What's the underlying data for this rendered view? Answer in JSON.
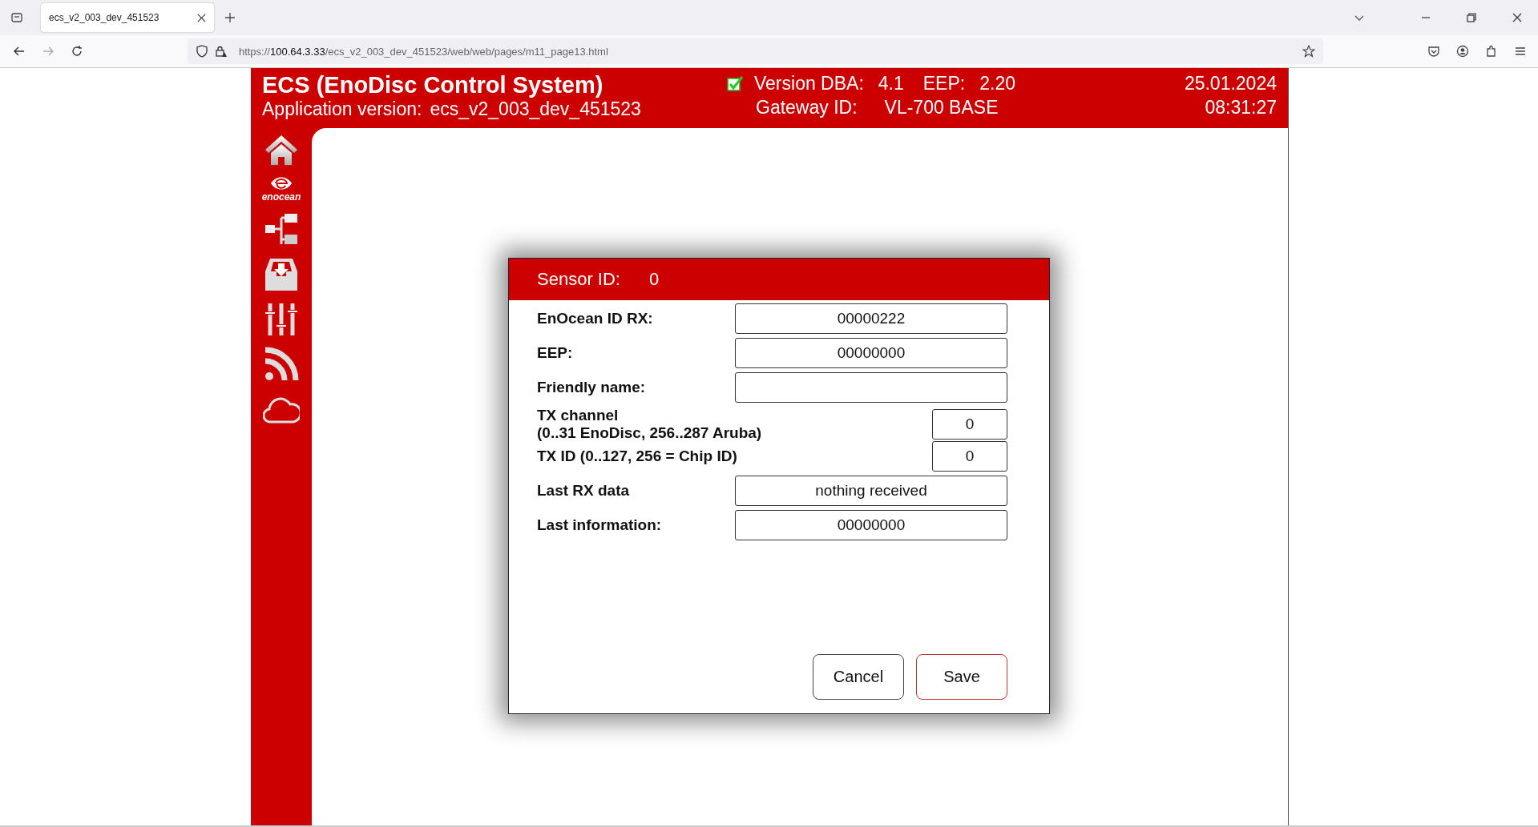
{
  "browser": {
    "tab_title": "ecs_v2_003_dev_451523",
    "url_scheme": "https://",
    "url_host": "100.64.3.33",
    "url_path": "/ecs_v2_003_dev_451523/web/web/pages/m11_page13.html"
  },
  "header": {
    "title": "ECS (EnoDisc Control System)",
    "app_version_label": "Application version:",
    "app_version": "ecs_v2_003_dev_451523",
    "connected": true,
    "dba_label": "Version DBA:",
    "dba": "4.1",
    "eep_label": "EEP:",
    "eep": "2.20",
    "gateway_label": "Gateway ID:",
    "gateway": "VL-700 BASE",
    "date": "25.01.2024",
    "time": "08:31:27"
  },
  "sidebar": {
    "items": [
      {
        "kind": "home"
      },
      {
        "kind": "enocean",
        "label": "enocean"
      },
      {
        "kind": "tree"
      },
      {
        "kind": "inbox"
      },
      {
        "kind": "sliders"
      },
      {
        "kind": "rss"
      },
      {
        "kind": "cloud"
      }
    ]
  },
  "dialog": {
    "title_label": "Sensor ID:",
    "title_value": "0",
    "fields": [
      {
        "kind": "wide",
        "label": "EnOcean ID RX:",
        "value": "00000222"
      },
      {
        "kind": "wide",
        "label": "EEP:",
        "value": "00000000"
      },
      {
        "kind": "wide",
        "label": "Friendly name:"
      },
      {
        "kind": "narrow",
        "label": "TX channel",
        "sublabel": "(0..31 EnoDisc, 256..287 Aruba)",
        "value": "0"
      },
      {
        "kind": "narrow",
        "label": "TX ID (0..127, 256 = Chip ID)",
        "value": "0"
      },
      {
        "kind": "wide",
        "label": "Last RX data",
        "value": "nothing received"
      },
      {
        "kind": "wide",
        "label": "Last information:",
        "value": "00000000"
      }
    ],
    "buttons": [
      {
        "kind": "cancel",
        "label": "Cancel"
      },
      {
        "kind": "save",
        "label": "Save"
      }
    ]
  }
}
